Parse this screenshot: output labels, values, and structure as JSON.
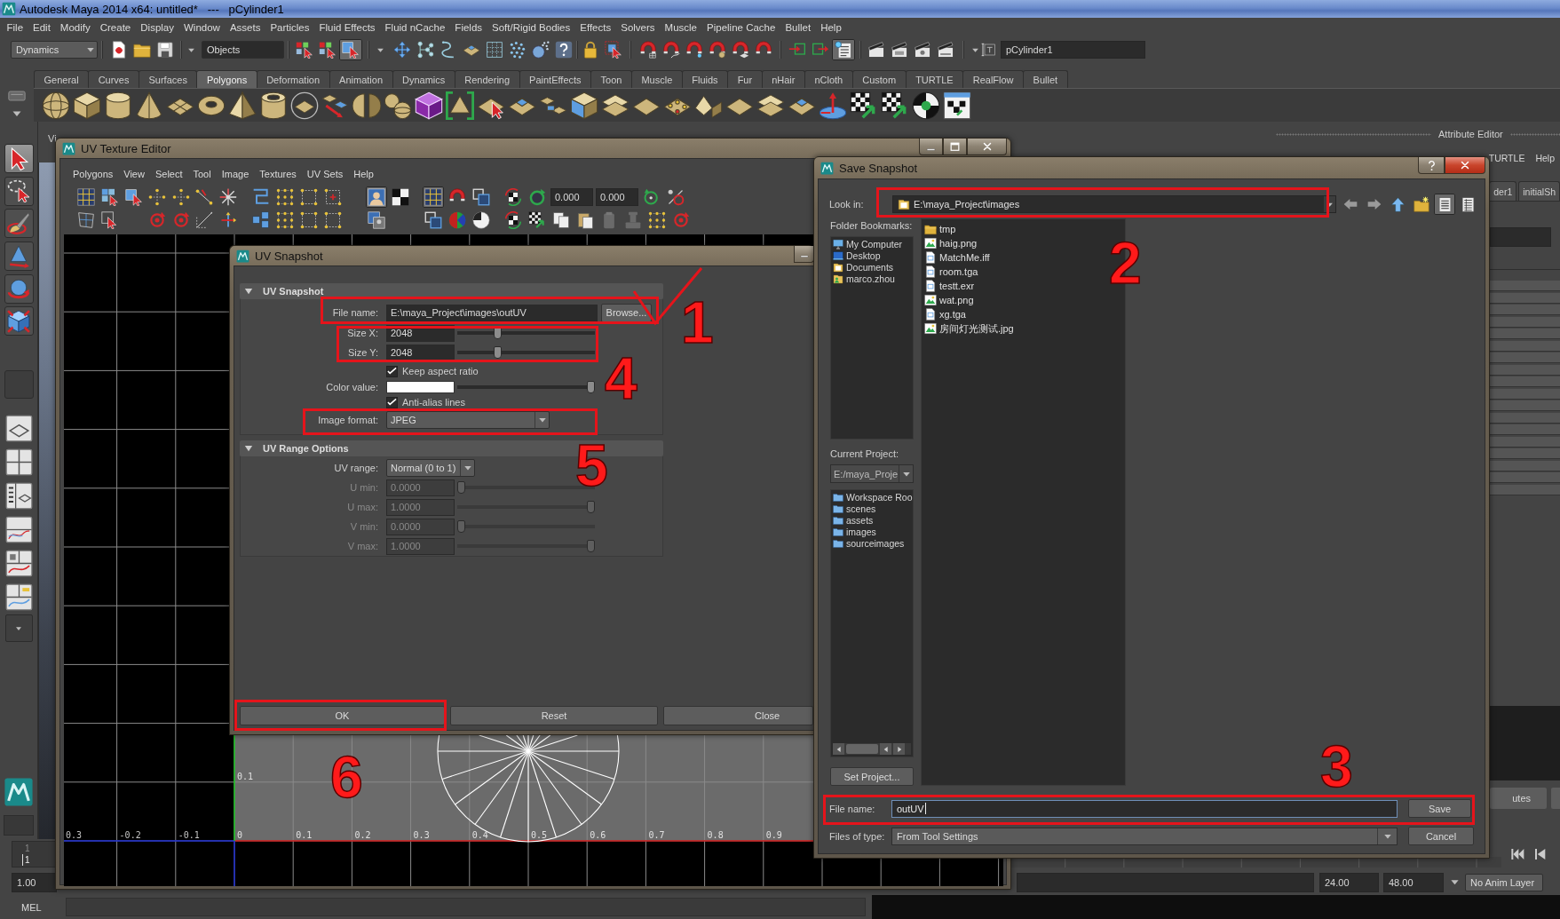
{
  "window": {
    "title": "Autodesk Maya 2014 x64: untitled*   ---   pCylinder1"
  },
  "menu_bar": [
    "File",
    "Edit",
    "Modify",
    "Create",
    "Display",
    "Window",
    "Assets",
    "Particles",
    "Fluid Effects",
    "Fluid nCache",
    "Fields",
    "Soft/Rigid Bodies",
    "Effects",
    "Solvers",
    "Muscle",
    "Pipeline Cache",
    "Bullet",
    "Help"
  ],
  "status_line": {
    "menu_set": "Dynamics",
    "selection_mask": "Objects",
    "mode_buttons": [
      {
        "selected": false
      },
      {
        "selected": false
      },
      {
        "selected": true
      }
    ],
    "panel_toggles": [
      {
        "selected": false
      },
      {
        "selected": false
      },
      {
        "selected": true
      }
    ],
    "name_field": "pCylinder1"
  },
  "shelf": {
    "tabs": [
      {
        "label": "General",
        "selected": false
      },
      {
        "label": "Curves",
        "selected": false
      },
      {
        "label": "Surfaces",
        "selected": false
      },
      {
        "label": "Polygons",
        "selected": true
      },
      {
        "label": "Deformation",
        "selected": false
      },
      {
        "label": "Animation",
        "selected": false
      },
      {
        "label": "Dynamics",
        "selected": false
      },
      {
        "label": "Rendering",
        "selected": false
      },
      {
        "label": "PaintEffects",
        "selected": false
      },
      {
        "label": "Toon",
        "selected": false
      },
      {
        "label": "Muscle",
        "selected": false
      },
      {
        "label": "Fluids",
        "selected": false
      },
      {
        "label": "Fur",
        "selected": false
      },
      {
        "label": "nHair",
        "selected": false
      },
      {
        "label": "nCloth",
        "selected": false
      },
      {
        "label": "Custom",
        "selected": false
      },
      {
        "label": "TURTLE",
        "selected": false
      },
      {
        "label": "RealFlow",
        "selected": false
      },
      {
        "label": "Bullet",
        "selected": false
      }
    ]
  },
  "toolbox": {
    "tools": [
      {
        "selected": true
      },
      {
        "selected": false
      },
      {
        "selected": false
      },
      {
        "selected": false
      },
      {
        "selected": false
      },
      {
        "selected": false
      }
    ]
  },
  "view_panel": {
    "menu": "Vi"
  },
  "attribute_editor": {
    "title": "Attribute Editor",
    "menu": [
      "TURTLE",
      "Help"
    ],
    "tabs": [
      "der1",
      "initialSh"
    ],
    "button": "utes"
  },
  "time_slider": {
    "frame_label": "1",
    "current_frame": "1"
  },
  "range_slider": {
    "start": "1.00",
    "end": "24.00",
    "max": "48.00",
    "anim_layer": "No Anim Layer"
  },
  "command_line": {
    "language": "MEL"
  },
  "uv_texture_editor": {
    "title": "UV Texture Editor",
    "menu": [
      "Polygons",
      "View",
      "Select",
      "Tool",
      "Image",
      "Textures",
      "UV Sets",
      "Help"
    ],
    "toolbar_toggles": [
      {
        "selected": true
      },
      {
        "selected": true
      }
    ],
    "fields": [
      "0.000",
      "0.000"
    ],
    "u_labels": [
      "0.3",
      "-0.2",
      "-0.1",
      "0",
      "0.1",
      "0.2",
      "0.3",
      "0.4",
      "0.5",
      "0.6",
      "0.7",
      "0.8",
      "0.9"
    ],
    "v_labels": [
      "0.1"
    ]
  },
  "uv_snapshot": {
    "title": "UV Snapshot",
    "sections": [
      {
        "title": "UV Snapshot",
        "expanded": true,
        "rows": [
          {
            "kind": "file",
            "label": "File name:",
            "value": "E:\\maya_Project\\images\\outUV",
            "button": "Browse..."
          },
          {
            "kind": "slider",
            "label": "Size X:",
            "value": "2048",
            "level": 0.28,
            "disabled": false
          },
          {
            "kind": "slider",
            "label": "Size Y:",
            "value": "2048",
            "level": 0.28,
            "disabled": false
          },
          {
            "kind": "checkbox",
            "label": "Keep aspect ratio",
            "checked": true
          },
          {
            "kind": "color",
            "label": "Color value:",
            "color": "#ffffff",
            "level": 1
          },
          {
            "kind": "checkbox",
            "label": "Anti-alias lines",
            "checked": true
          },
          {
            "kind": "dropdown",
            "label": "Image format:",
            "value": "JPEG"
          }
        ]
      },
      {
        "title": "UV Range Options",
        "expanded": true,
        "rows": [
          {
            "kind": "dropdown",
            "label": "UV range:",
            "value": "Normal (0 to 1)"
          },
          {
            "kind": "slider",
            "label": "U min:",
            "value": "0.0000",
            "level": 0,
            "disabled": true
          },
          {
            "kind": "slider",
            "label": "U max:",
            "value": "1.0000",
            "level": 1,
            "disabled": true
          },
          {
            "kind": "slider",
            "label": "V min:",
            "value": "0.0000",
            "level": 0,
            "disabled": true
          },
          {
            "kind": "slider",
            "label": "V max:",
            "value": "1.0000",
            "level": 1,
            "disabled": true
          }
        ]
      }
    ],
    "buttons": [
      "OK",
      "Reset",
      "Close"
    ]
  },
  "save_snapshot": {
    "title": "Save Snapshot",
    "look_in_label": "Look in:",
    "look_in": "E:\\maya_Project\\images",
    "views": [
      {
        "kind": "list",
        "selected": true
      },
      {
        "kind": "detail",
        "selected": false
      }
    ],
    "bookmarks_label": "Folder Bookmarks:",
    "bookmarks": [
      {
        "label": "My Computer",
        "kind": "computer"
      },
      {
        "label": "Desktop",
        "kind": "desktop"
      },
      {
        "label": "Documents",
        "kind": "folder"
      },
      {
        "label": "marco.zhou",
        "kind": "user"
      }
    ],
    "project_label": "Current Project:",
    "project": "E:/maya_Proje",
    "project_folders": [
      "Workspace Roo",
      "scenes",
      "assets",
      "images",
      "sourceimages"
    ],
    "set_project": "Set Project...",
    "files": [
      {
        "name": "tmp",
        "kind": "folder"
      },
      {
        "name": "haig.png",
        "kind": "image"
      },
      {
        "name": "MatchMe.iff",
        "kind": "document"
      },
      {
        "name": "room.tga",
        "kind": "document"
      },
      {
        "name": "testt.exr",
        "kind": "document"
      },
      {
        "name": "wat.png",
        "kind": "image"
      },
      {
        "name": "xg.tga",
        "kind": "document"
      },
      {
        "name": "房间灯光测试.jpg",
        "kind": "image"
      }
    ],
    "file_name_label": "File name:",
    "file_name": "outUV",
    "file_type_label": "Files of type:",
    "file_type": "From Tool Settings",
    "buttons": [
      "Save",
      "Cancel"
    ]
  },
  "annotations": [
    {
      "label": "1",
      "tick": true
    },
    {
      "label": "2",
      "tick": false
    },
    {
      "label": "3",
      "tick": false
    },
    {
      "label": "4",
      "tick": false
    },
    {
      "label": "5",
      "tick": false
    },
    {
      "label": "6",
      "tick": false
    }
  ]
}
